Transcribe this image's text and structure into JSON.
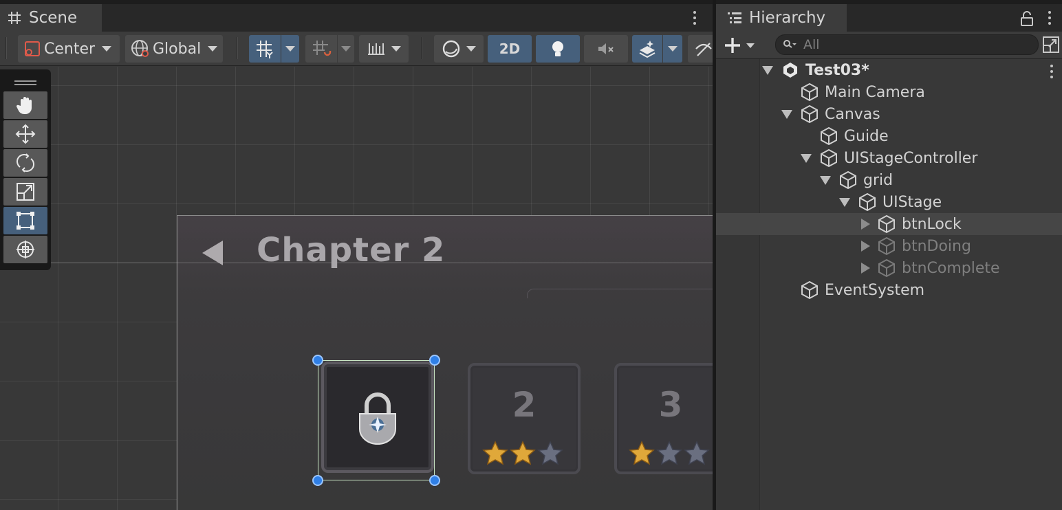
{
  "scene": {
    "tab_label": "Scene",
    "toolbar": {
      "pivot_label": "Center",
      "space_label": "Global",
      "mode_2d_label": "2D"
    },
    "canvas": {
      "chapter_title": "Chapter 2",
      "stages": [
        {
          "state": "locked",
          "number": ""
        },
        {
          "state": "complete",
          "number": "2",
          "stars_earned": 2,
          "stars_total": 3
        },
        {
          "state": "complete",
          "number": "3",
          "stars_earned": 1,
          "stars_total": 3
        }
      ]
    },
    "tools": [
      "hand-tool",
      "move-tool",
      "rotate-tool",
      "scale-tool",
      "rect-tool",
      "transform-tool"
    ],
    "active_tool": "rect-tool"
  },
  "hierarchy": {
    "tab_label": "Hierarchy",
    "search_placeholder": "All",
    "items": [
      {
        "label": "Test03*",
        "depth": 0,
        "fold": "open",
        "type": "scene",
        "state": "normal"
      },
      {
        "label": "Main Camera",
        "depth": 1,
        "fold": "none",
        "type": "gameobject",
        "state": "normal"
      },
      {
        "label": "Canvas",
        "depth": 1,
        "fold": "open",
        "type": "gameobject",
        "state": "normal"
      },
      {
        "label": "Guide",
        "depth": 2,
        "fold": "none",
        "type": "gameobject",
        "state": "normal"
      },
      {
        "label": "UIStageController",
        "depth": 2,
        "fold": "open",
        "type": "gameobject",
        "state": "normal"
      },
      {
        "label": "grid",
        "depth": 3,
        "fold": "open",
        "type": "gameobject",
        "state": "normal"
      },
      {
        "label": "UIStage",
        "depth": 4,
        "fold": "open",
        "type": "gameobject",
        "state": "normal"
      },
      {
        "label": "btnLock",
        "depth": 5,
        "fold": "closed",
        "type": "gameobject",
        "state": "selected"
      },
      {
        "label": "btnDoing",
        "depth": 5,
        "fold": "closed",
        "type": "gameobject",
        "state": "inactive"
      },
      {
        "label": "btnComplete",
        "depth": 5,
        "fold": "closed",
        "type": "gameobject",
        "state": "inactive"
      },
      {
        "label": "EventSystem",
        "depth": 1,
        "fold": "none",
        "type": "gameobject",
        "state": "normal"
      }
    ]
  },
  "colors": {
    "accent_active": "#46607c",
    "selection_handle": "#2f7fe6",
    "star_gold": "#e0a83a",
    "star_empty": "#6a6f80"
  }
}
